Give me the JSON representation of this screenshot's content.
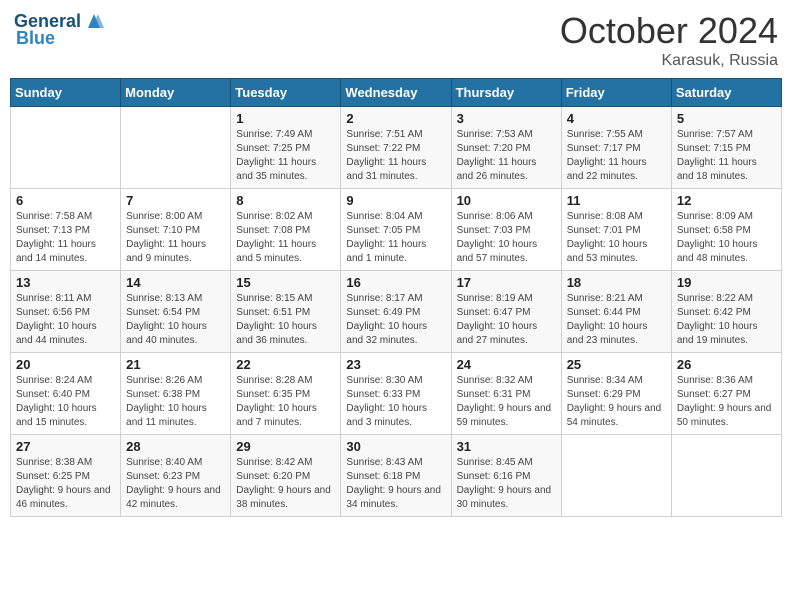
{
  "logo": {
    "line1": "General",
    "line2": "Blue"
  },
  "title": "October 2024",
  "location": "Karasuk, Russia",
  "weekdays": [
    "Sunday",
    "Monday",
    "Tuesday",
    "Wednesday",
    "Thursday",
    "Friday",
    "Saturday"
  ],
  "weeks": [
    [
      null,
      null,
      {
        "day": "1",
        "sunrise": "7:49 AM",
        "sunset": "7:25 PM",
        "daylight": "11 hours and 35 minutes."
      },
      {
        "day": "2",
        "sunrise": "7:51 AM",
        "sunset": "7:22 PM",
        "daylight": "11 hours and 31 minutes."
      },
      {
        "day": "3",
        "sunrise": "7:53 AM",
        "sunset": "7:20 PM",
        "daylight": "11 hours and 26 minutes."
      },
      {
        "day": "4",
        "sunrise": "7:55 AM",
        "sunset": "7:17 PM",
        "daylight": "11 hours and 22 minutes."
      },
      {
        "day": "5",
        "sunrise": "7:57 AM",
        "sunset": "7:15 PM",
        "daylight": "11 hours and 18 minutes."
      }
    ],
    [
      {
        "day": "6",
        "sunrise": "7:58 AM",
        "sunset": "7:13 PM",
        "daylight": "11 hours and 14 minutes."
      },
      {
        "day": "7",
        "sunrise": "8:00 AM",
        "sunset": "7:10 PM",
        "daylight": "11 hours and 9 minutes."
      },
      {
        "day": "8",
        "sunrise": "8:02 AM",
        "sunset": "7:08 PM",
        "daylight": "11 hours and 5 minutes."
      },
      {
        "day": "9",
        "sunrise": "8:04 AM",
        "sunset": "7:05 PM",
        "daylight": "11 hours and 1 minute."
      },
      {
        "day": "10",
        "sunrise": "8:06 AM",
        "sunset": "7:03 PM",
        "daylight": "10 hours and 57 minutes."
      },
      {
        "day": "11",
        "sunrise": "8:08 AM",
        "sunset": "7:01 PM",
        "daylight": "10 hours and 53 minutes."
      },
      {
        "day": "12",
        "sunrise": "8:09 AM",
        "sunset": "6:58 PM",
        "daylight": "10 hours and 48 minutes."
      }
    ],
    [
      {
        "day": "13",
        "sunrise": "8:11 AM",
        "sunset": "6:56 PM",
        "daylight": "10 hours and 44 minutes."
      },
      {
        "day": "14",
        "sunrise": "8:13 AM",
        "sunset": "6:54 PM",
        "daylight": "10 hours and 40 minutes."
      },
      {
        "day": "15",
        "sunrise": "8:15 AM",
        "sunset": "6:51 PM",
        "daylight": "10 hours and 36 minutes."
      },
      {
        "day": "16",
        "sunrise": "8:17 AM",
        "sunset": "6:49 PM",
        "daylight": "10 hours and 32 minutes."
      },
      {
        "day": "17",
        "sunrise": "8:19 AM",
        "sunset": "6:47 PM",
        "daylight": "10 hours and 27 minutes."
      },
      {
        "day": "18",
        "sunrise": "8:21 AM",
        "sunset": "6:44 PM",
        "daylight": "10 hours and 23 minutes."
      },
      {
        "day": "19",
        "sunrise": "8:22 AM",
        "sunset": "6:42 PM",
        "daylight": "10 hours and 19 minutes."
      }
    ],
    [
      {
        "day": "20",
        "sunrise": "8:24 AM",
        "sunset": "6:40 PM",
        "daylight": "10 hours and 15 minutes."
      },
      {
        "day": "21",
        "sunrise": "8:26 AM",
        "sunset": "6:38 PM",
        "daylight": "10 hours and 11 minutes."
      },
      {
        "day": "22",
        "sunrise": "8:28 AM",
        "sunset": "6:35 PM",
        "daylight": "10 hours and 7 minutes."
      },
      {
        "day": "23",
        "sunrise": "8:30 AM",
        "sunset": "6:33 PM",
        "daylight": "10 hours and 3 minutes."
      },
      {
        "day": "24",
        "sunrise": "8:32 AM",
        "sunset": "6:31 PM",
        "daylight": "9 hours and 59 minutes."
      },
      {
        "day": "25",
        "sunrise": "8:34 AM",
        "sunset": "6:29 PM",
        "daylight": "9 hours and 54 minutes."
      },
      {
        "day": "26",
        "sunrise": "8:36 AM",
        "sunset": "6:27 PM",
        "daylight": "9 hours and 50 minutes."
      }
    ],
    [
      {
        "day": "27",
        "sunrise": "8:38 AM",
        "sunset": "6:25 PM",
        "daylight": "9 hours and 46 minutes."
      },
      {
        "day": "28",
        "sunrise": "8:40 AM",
        "sunset": "6:23 PM",
        "daylight": "9 hours and 42 minutes."
      },
      {
        "day": "29",
        "sunrise": "8:42 AM",
        "sunset": "6:20 PM",
        "daylight": "9 hours and 38 minutes."
      },
      {
        "day": "30",
        "sunrise": "8:43 AM",
        "sunset": "6:18 PM",
        "daylight": "9 hours and 34 minutes."
      },
      {
        "day": "31",
        "sunrise": "8:45 AM",
        "sunset": "6:16 PM",
        "daylight": "9 hours and 30 minutes."
      },
      null,
      null
    ]
  ],
  "labels": {
    "sunrise_prefix": "Sunrise: ",
    "sunset_prefix": "Sunset: ",
    "daylight_prefix": "Daylight: "
  }
}
